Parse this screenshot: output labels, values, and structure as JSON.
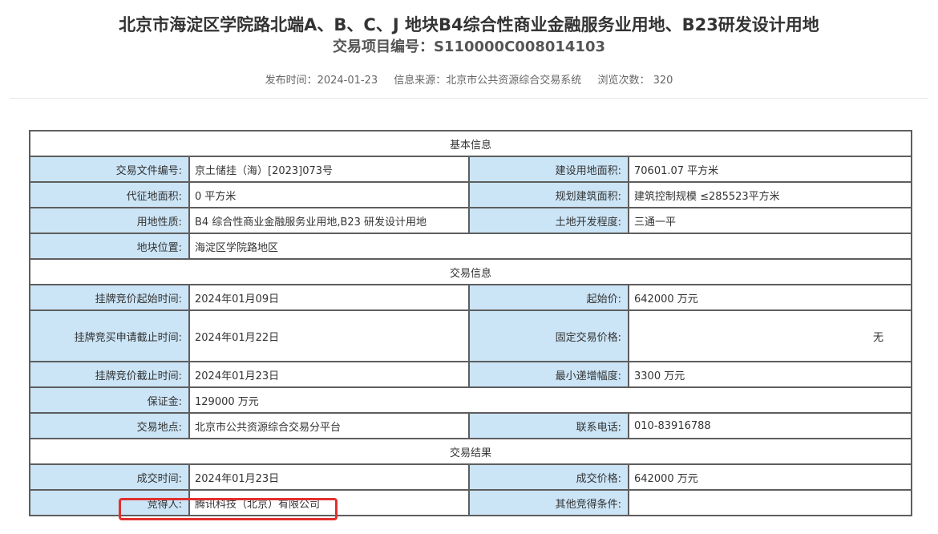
{
  "page": {
    "title": "北京市海淀区学院路北端A、B、C、J 地块B4综合性商业金融服务业用地、B23研发设计用地",
    "subtitle": "交易项目编号：S110000C008014103",
    "publish_time": "发布时间：2024-01-23",
    "source": "信息来源：北京市公共资源综合交易系统",
    "views": "浏览次数： 320"
  },
  "sections": {
    "basic": "基本信息",
    "trade": "交易信息",
    "result": "交易结果"
  },
  "basic": {
    "doc_no_label": "交易文件编号:",
    "doc_no": "京土储挂（海）[2023]073号",
    "land_area_label": "建设用地面积:",
    "land_area": "70601.07 平方米",
    "acq_area_label": "代征地面积:",
    "acq_area": "0 平方米",
    "plan_area_label": "规划建筑面积:",
    "plan_area": "建筑控制规模 ≤285523平方米",
    "use_label": "用地性质:",
    "use": "B4 综合性商业金融服务业用地,B23 研发设计用地",
    "dev_label": "土地开发程度:",
    "dev": "三通一平",
    "location_label": "地块位置:",
    "location": "海淀区学院路地区"
  },
  "trade": {
    "start_label": "挂牌竞价起始时间:",
    "start": "2024年01月09日",
    "start_price_label": "起始价:",
    "start_price": "642000 万元",
    "apply_end_label": "挂牌竞买申请截止时间:",
    "apply_end": "2024年01月22日",
    "fixed_price_label": "固定交易价格:",
    "fixed_price": "无",
    "bid_end_label": "挂牌竞价截止时间:",
    "bid_end": "2024年01月23日",
    "min_inc_label": "最小递增幅度:",
    "min_inc": "3300 万元",
    "deposit_label": "保证金:",
    "deposit": "129000 万元",
    "place_label": "交易地点:",
    "place": "北京市公共资源综合交易分平台",
    "phone_label": "联系电话:",
    "phone": "010-83916788"
  },
  "result": {
    "deal_time_label": "成交时间:",
    "deal_time": "2024年01月23日",
    "deal_price_label": "成交价格:",
    "deal_price": "642000 万元",
    "winner_label": "竞得人:",
    "winner": "腾讯科技（北京）有限公司",
    "other_label": "其他竞得条件:",
    "other": ""
  },
  "colors": {
    "label_bg": "#cbe4f6",
    "border": "#5e5e5e",
    "highlight": "#e0312e"
  }
}
